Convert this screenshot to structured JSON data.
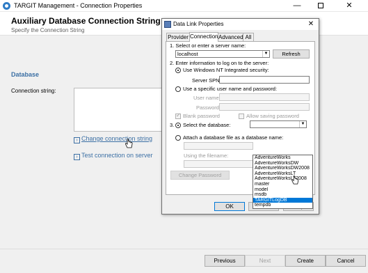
{
  "window": {
    "title": "TARGIT Management - Connection Properties",
    "minimize": "—",
    "close": "✕"
  },
  "header": {
    "title": "Auxiliary Database Connection String",
    "subtitle": "Specify the Connection String"
  },
  "main": {
    "section_title": "Database",
    "connection_label": "Connection string:",
    "connection_value": "",
    "change_link": "Change connection string",
    "test_link": "Test connection on server"
  },
  "footer": {
    "previous": "Previous",
    "next": "Next",
    "create": "Create",
    "cancel": "Cancel"
  },
  "dialog": {
    "title": "Data Link Properties",
    "close": "✕",
    "tabs": [
      "Provider",
      "Connection",
      "Advanced",
      "All"
    ],
    "active_tab": "Connection",
    "step1_label": "1. Select or enter a server name:",
    "server_value": "localhost",
    "refresh": "Refresh",
    "step2_label": "2. Enter information to log on to the server:",
    "use_nt": "Use Windows NT Integrated security:",
    "server_spn_label": "Server SPN:",
    "server_spn_value": "",
    "use_specific": "Use a specific user name and password:",
    "user_name_label": "User name:",
    "password_label": "Password:",
    "blank_password": "Blank password",
    "allow_saving": "Allow saving password",
    "step3_label": "3.",
    "select_db": "Select the database:",
    "attach_label": "Attach a database file as a database name:",
    "using_filename": "Using the filename:",
    "change_password": "Change Password",
    "database_options": [
      "AdventureWorks",
      "AdventureWorksDW",
      "AdventureWorksDW2008",
      "AdventureWorksLT",
      "AdventureWorksLT2008",
      "master",
      "model",
      "msdb",
      "TARGITLogDB",
      "tempdb"
    ],
    "highlighted_option": "TARGITLogDB",
    "ok": "OK",
    "cancel": "Cancel",
    "help": "Help"
  },
  "colors": {
    "link": "#3b6fa4",
    "selection": "#0078d7",
    "panel_bg": "#f0f0f0"
  },
  "icons": {
    "app": "targit-app-icon",
    "dialog": "data-link-icon",
    "link_chevron": "chevron-right-icon",
    "cursor": "hand-pointer-icon"
  }
}
